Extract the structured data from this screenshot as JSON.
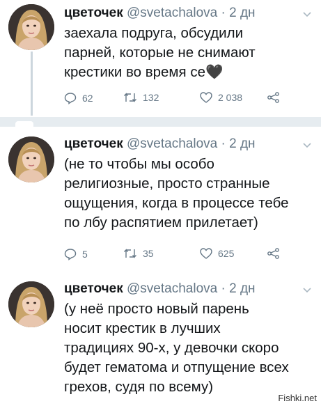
{
  "tweets": [
    {
      "name": "цветочек",
      "handle": "@svetachalova",
      "sep": "·",
      "time": "2 дн",
      "lines": [
        "заехала подруга, обсудили",
        "парней, которые не снимают",
        "крестики во время се"
      ],
      "emoji": "🖤",
      "replies": "62",
      "retweets": "132",
      "likes": "2 038"
    },
    {
      "name": "цветочек",
      "handle": "@svetachalova",
      "sep": "·",
      "time": "2 дн",
      "lines": [
        "(не то чтобы мы особо",
        "религиозные, просто странные",
        "ощущения, когда в процессе тебе",
        "по лбу распятием прилетает)"
      ],
      "replies": "5",
      "retweets": "35",
      "likes": "625"
    },
    {
      "name": "цветочек",
      "handle": "@svetachalova",
      "sep": "·",
      "time": "2 дн",
      "lines": [
        "(у неё просто новый парень",
        "носит крестик в лучших",
        "традициях 90-х, у девочки скоро",
        "будет гематома и отпущение всех",
        "грехов, судя по всему)"
      ]
    }
  ],
  "icons": {
    "reply": "reply-icon",
    "retweet": "retweet-icon",
    "like": "heart-icon",
    "share": "share-icon",
    "more": "chevron-down-icon"
  },
  "colors": {
    "muted": "#657786",
    "divider": "#e6ecf0",
    "thread": "#ccd6dd"
  },
  "watermark": "Fishki.net"
}
